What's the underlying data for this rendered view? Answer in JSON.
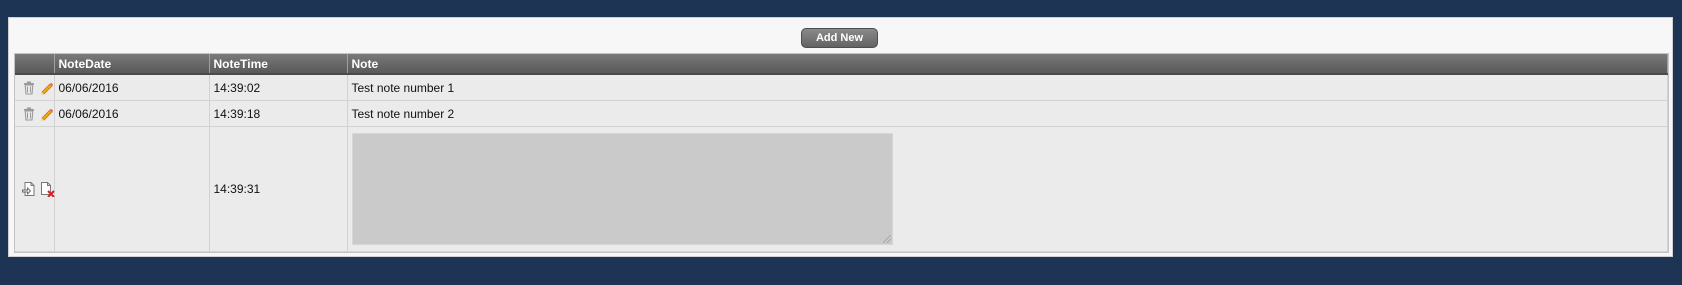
{
  "toolbar": {
    "add_label": "Add New"
  },
  "grid": {
    "columns": [
      "",
      "NoteDate",
      "NoteTime",
      "Note"
    ],
    "rows": [
      {
        "date": "06/06/2016",
        "time": "14:39:02",
        "note": "Test note number 1"
      },
      {
        "date": "06/06/2016",
        "time": "14:39:18",
        "note": "Test note number 2"
      }
    ],
    "edit_row": {
      "date": "",
      "time": "14:39:31",
      "note_value": ""
    }
  },
  "icons": {
    "delete": "trash-icon",
    "edit": "pencil-icon",
    "save": "save-document-icon",
    "cancel": "cancel-document-icon"
  },
  "colors": {
    "page_background": "#1e3454",
    "header_background": "#6b6b6b",
    "row_background": "#ebebeb",
    "textarea_background": "#cacaca"
  }
}
